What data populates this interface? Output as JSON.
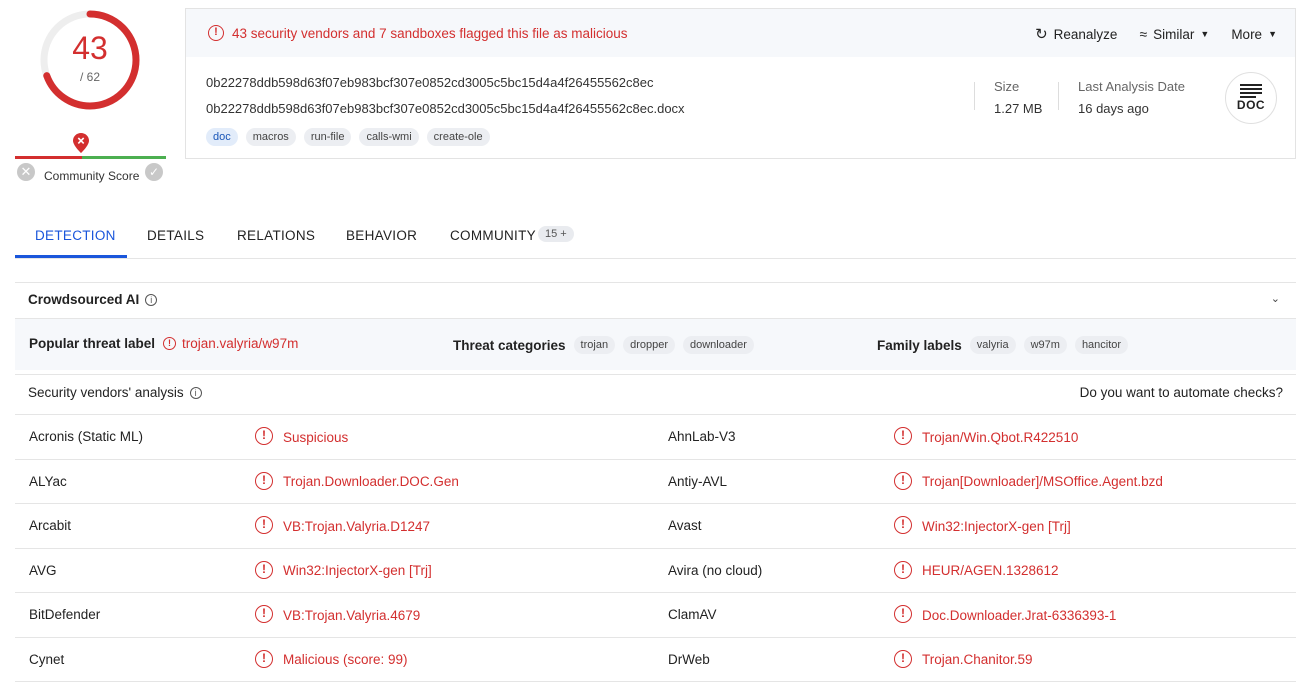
{
  "score": {
    "detected": "43",
    "total": "/ 62",
    "fraction": 0.6935,
    "community_label": "Community Score"
  },
  "alert": "43 security vendors and 7 sandboxes flagged this file as malicious",
  "actions": {
    "reanalyze": "Reanalyze",
    "similar": "Similar",
    "more": "More"
  },
  "file": {
    "hash": "0b22278ddb598d63f07eb983bcf307e0852cd3005c5bc15d4a4f26455562c8ec",
    "name": "0b22278ddb598d63f07eb983bcf307e0852cd3005c5bc15d4a4f26455562c8ec.docx",
    "tags": [
      "doc",
      "macros",
      "run-file",
      "calls-wmi",
      "create-ole"
    ],
    "size_label": "Size",
    "size": "1.27 MB",
    "date_label": "Last Analysis Date",
    "date": "16 days ago",
    "type": "DOC"
  },
  "tabs": [
    "DETECTION",
    "DETAILS",
    "RELATIONS",
    "BEHAVIOR",
    "COMMUNITY"
  ],
  "community_badge": "15 +",
  "crowdsourced": {
    "label": "Crowdsourced AI"
  },
  "threat": {
    "popular_label": "Popular threat label",
    "popular_value": "trojan.valyria/w97m",
    "categories_label": "Threat categories",
    "categories": [
      "trojan",
      "dropper",
      "downloader"
    ],
    "family_label": "Family labels",
    "families": [
      "valyria",
      "w97m",
      "hancitor"
    ]
  },
  "vendors_header": {
    "label": "Security vendors' analysis",
    "automate": "Do you want to automate checks?"
  },
  "vendors": [
    {
      "l_name": "Acronis (Static ML)",
      "l_res": "Suspicious",
      "r_name": "AhnLab-V3",
      "r_res": "Trojan/Win.Qbot.R422510"
    },
    {
      "l_name": "ALYac",
      "l_res": "Trojan.Downloader.DOC.Gen",
      "r_name": "Antiy-AVL",
      "r_res": "Trojan[Downloader]/MSOffice.Agent.bzd"
    },
    {
      "l_name": "Arcabit",
      "l_res": "VB:Trojan.Valyria.D1247",
      "r_name": "Avast",
      "r_res": "Win32:InjectorX-gen [Trj]"
    },
    {
      "l_name": "AVG",
      "l_res": "Win32:InjectorX-gen [Trj]",
      "r_name": "Avira (no cloud)",
      "r_res": "HEUR/AGEN.1328612"
    },
    {
      "l_name": "BitDefender",
      "l_res": "VB:Trojan.Valyria.4679",
      "r_name": "ClamAV",
      "r_res": "Doc.Downloader.Jrat-6336393-1"
    },
    {
      "l_name": "Cynet",
      "l_res": "Malicious (score: 99)",
      "r_name": "DrWeb",
      "r_res": "Trojan.Chanitor.59"
    }
  ],
  "colors": {
    "malicious": "#d32f2f",
    "accent": "#1a56db",
    "clean": "#4caf50"
  }
}
